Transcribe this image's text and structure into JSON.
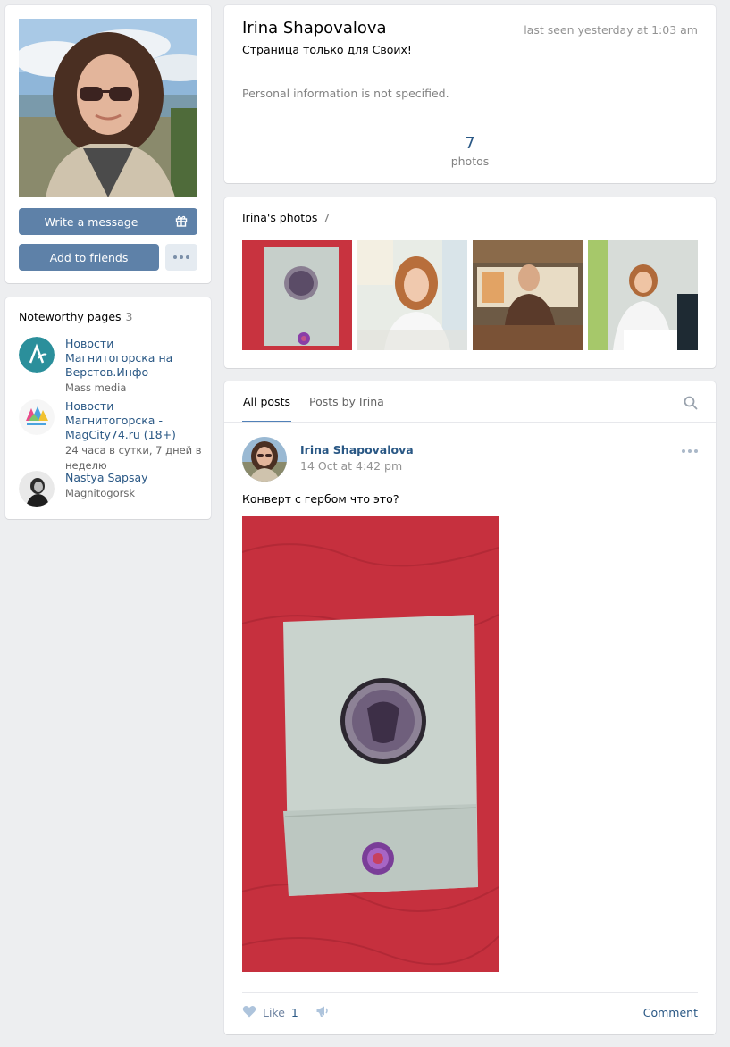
{
  "profile": {
    "name": "Irina Shapovalova",
    "last_seen": "last seen yesterday at 1:03 am",
    "status": "Страница только для Своих!",
    "info_empty": "Personal information is not specified.",
    "counter_value": "7",
    "counter_label": "photos"
  },
  "actions": {
    "write_message": "Write a message",
    "gift_icon": "gift-icon",
    "add_friends": "Add to friends",
    "more_icon": "ellipsis-icon"
  },
  "noteworthy": {
    "title": "Noteworthy pages",
    "count": "3",
    "items": [
      {
        "name": "Новости Магнитогорска на Верстов.Инфо",
        "sub": "Mass media"
      },
      {
        "name": "Новости Магнитогорска - MagCity74.ru (18+)",
        "sub": "24 часа в сутки, 7 дней в неделю"
      },
      {
        "name": "Nastya Sapsay",
        "sub": "Magnitogorsk"
      }
    ]
  },
  "photos": {
    "title": "Irina's photos",
    "count": "7"
  },
  "wall": {
    "tabs": [
      "All posts",
      "Posts by Irina"
    ],
    "active_tab": 0,
    "search_icon": "search-icon"
  },
  "post": {
    "author": "Irina Shapovalova",
    "date": "14 Oct at 4:42 pm",
    "text": "Конверт с гербом что это?",
    "like_label": "Like",
    "like_count": "1",
    "comment_label": "Comment"
  },
  "colors": {
    "link": "#2a5885",
    "button": "#5e81a8",
    "background": "#edeef0"
  }
}
